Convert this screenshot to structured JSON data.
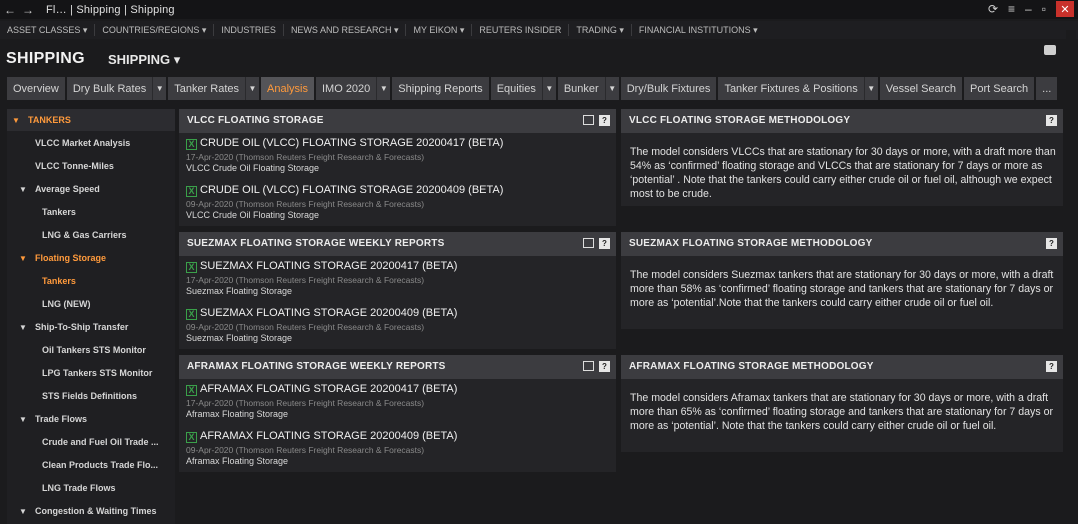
{
  "window": {
    "title": "Fl… | Shipping | Shipping"
  },
  "topmenu": [
    "ASSET CLASSES ▾",
    "COUNTRIES/REGIONS ▾",
    "INDUSTRIES",
    "NEWS AND RESEARCH ▾",
    "MY EIKON ▾",
    "REUTERS INSIDER",
    "TRADING ▾",
    "FINANCIAL INSTITUTIONS ▾"
  ],
  "app": {
    "title": "SHIPPING",
    "subtitle": "SHIPPING ▾"
  },
  "tabs": [
    {
      "label": "Overview",
      "dd": false,
      "active": false
    },
    {
      "label": "Dry Bulk Rates",
      "dd": true,
      "active": false
    },
    {
      "label": "Tanker Rates",
      "dd": true,
      "active": false
    },
    {
      "label": "Analysis",
      "dd": false,
      "active": true
    },
    {
      "label": "IMO 2020",
      "dd": true,
      "active": false
    },
    {
      "label": "Shipping Reports",
      "dd": false,
      "active": false
    },
    {
      "label": "Equities",
      "dd": true,
      "active": false
    },
    {
      "label": "Bunker",
      "dd": true,
      "active": false
    },
    {
      "label": "Dry/Bulk Fixtures",
      "dd": false,
      "active": false
    },
    {
      "label": "Tanker Fixtures & Positions",
      "dd": true,
      "active": false
    },
    {
      "label": "Vessel Search",
      "dd": false,
      "active": false
    },
    {
      "label": "Port Search",
      "dd": false,
      "active": false
    },
    {
      "label": "...",
      "dd": false,
      "active": false
    }
  ],
  "sidebar": [
    {
      "label": "TANKERS",
      "level": 0,
      "arrow": true,
      "orange": true
    },
    {
      "label": "VLCC Market Analysis",
      "level": 1,
      "arrow": false,
      "orange": false
    },
    {
      "label": "VLCC Tonne-Miles",
      "level": 1,
      "arrow": false,
      "orange": false
    },
    {
      "label": "Average Speed",
      "level": 1,
      "arrow": true,
      "orange": false
    },
    {
      "label": "Tankers",
      "level": 2,
      "arrow": false,
      "orange": false
    },
    {
      "label": "LNG & Gas Carriers",
      "level": 2,
      "arrow": false,
      "orange": false
    },
    {
      "label": "Floating Storage",
      "level": 1,
      "arrow": true,
      "orange": true
    },
    {
      "label": "Tankers",
      "level": 2,
      "arrow": false,
      "orange": true
    },
    {
      "label": "LNG (NEW)",
      "level": 2,
      "arrow": false,
      "orange": false
    },
    {
      "label": "Ship-To-Ship Transfer",
      "level": 1,
      "arrow": true,
      "orange": false
    },
    {
      "label": "Oil Tankers STS Monitor",
      "level": 2,
      "arrow": false,
      "orange": false
    },
    {
      "label": "LPG Tankers STS Monitor",
      "level": 2,
      "arrow": false,
      "orange": false
    },
    {
      "label": "STS Fields Definitions",
      "level": 2,
      "arrow": false,
      "orange": false
    },
    {
      "label": "Trade Flows",
      "level": 1,
      "arrow": true,
      "orange": false
    },
    {
      "label": "Crude and Fuel Oil Trade ...",
      "level": 2,
      "arrow": false,
      "orange": false
    },
    {
      "label": "Clean Products Trade Flo...",
      "level": 2,
      "arrow": false,
      "orange": false
    },
    {
      "label": "LNG Trade Flows",
      "level": 2,
      "arrow": false,
      "orange": false
    },
    {
      "label": "Congestion & Waiting Times",
      "level": 1,
      "arrow": true,
      "orange": false
    }
  ],
  "sections": [
    {
      "left_title": "VLCC FLOATING STORAGE",
      "right_title": "VLCC FLOATING STORAGE METHODOLOGY",
      "reports": [
        {
          "title": "CRUDE OIL (VLCC) FLOATING STORAGE 20200417 (BETA)",
          "meta": "17-Apr-2020 (Thomson Reuters Freight Research & Forecasts)",
          "cat": "VLCC Crude Oil Floating Storage"
        },
        {
          "title": "CRUDE OIL (VLCC) FLOATING STORAGE 20200409 (BETA)",
          "meta": "09-Apr-2020 (Thomson Reuters Freight Research & Forecasts)",
          "cat": "VLCC Crude Oil Floating Storage"
        }
      ],
      "methodology": "The model considers VLCCs that are stationary for 30 days or more, with a draft more than 54% as ‘confirmed’ floating storage and VLCCs that are stationary for 7 days or more as ‘potential’ . Note that the tankers could carry either crude oil or fuel oil, although we expect most to be crude."
    },
    {
      "left_title": "SUEZMAX FLOATING STORAGE WEEKLY REPORTS",
      "right_title": "SUEZMAX FLOATING STORAGE METHODOLOGY",
      "reports": [
        {
          "title": "SUEZMAX FLOATING STORAGE 20200417 (BETA)",
          "meta": "17-Apr-2020 (Thomson Reuters Freight Research & Forecasts)",
          "cat": "Suezmax Floating Storage"
        },
        {
          "title": "SUEZMAX FLOATING STORAGE 20200409 (BETA)",
          "meta": "09-Apr-2020 (Thomson Reuters Freight Research & Forecasts)",
          "cat": "Suezmax Floating Storage"
        }
      ],
      "methodology": "The model considers Suezmax tankers that are stationary for 30 days or more, with a draft more than 58% as ‘confirmed’ floating storage and tankers that are stationary for 7 days or more as ‘potential’.Note that the tankers could carry either crude oil or fuel oil."
    },
    {
      "left_title": "AFRAMAX FLOATING STORAGE WEEKLY REPORTS",
      "right_title": "AFRAMAX FLOATING STORAGE METHODOLOGY",
      "reports": [
        {
          "title": "AFRAMAX FLOATING STORAGE 20200417 (BETA)",
          "meta": "17-Apr-2020 (Thomson Reuters Freight Research & Forecasts)",
          "cat": "Aframax Floating Storage"
        },
        {
          "title": "AFRAMAX FLOATING STORAGE 20200409 (BETA)",
          "meta": "09-Apr-2020 (Thomson Reuters Freight Research & Forecasts)",
          "cat": "Aframax Floating Storage"
        }
      ],
      "methodology": "The model considers Aframax tankers that are stationary for 30 days or more, with a draft more than 65% as ‘confirmed’ floating storage and tankers that are stationary for 7 days or more as ‘potential’. Note that the tankers could carry either crude oil or fuel oil."
    }
  ],
  "colors": {
    "accent": "#ff9a3c",
    "panel_header": "#3c3c40",
    "excel_green": "#3aa04a"
  }
}
